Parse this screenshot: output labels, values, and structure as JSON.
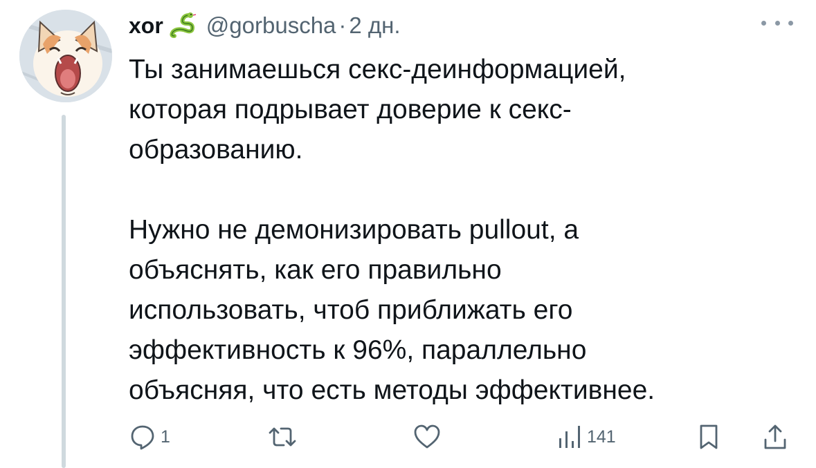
{
  "tweet": {
    "display_name": "xor",
    "name_emoji": "snake-emoji",
    "handle": "@gorbuscha",
    "separator": "·",
    "time": "2 дн.",
    "paragraphs": [
      "Ты занимаешься секс-деинформацией,\nкоторая подрывает доверие к секс-\nобразованию.",
      "Нужно не демонизировать pullout, а\nобъяснять, как его правильно\nиспользовать, чтоб приближать его\nэффективность к 96%, параллельно\nобъясняя, что есть методы эффективнее."
    ]
  },
  "actions": {
    "reply": {
      "icon": "reply-icon",
      "count": "1"
    },
    "retweet": {
      "icon": "retweet-icon",
      "count": ""
    },
    "like": {
      "icon": "heart-icon",
      "count": ""
    },
    "views": {
      "icon": "views-icon",
      "count": "141"
    },
    "bookmark": {
      "icon": "bookmark-icon"
    },
    "share": {
      "icon": "share-icon"
    }
  },
  "colors": {
    "text": "#0f1419",
    "secondary": "#536471",
    "thread_line": "#cfd9de",
    "snake": "#8cc63e"
  }
}
